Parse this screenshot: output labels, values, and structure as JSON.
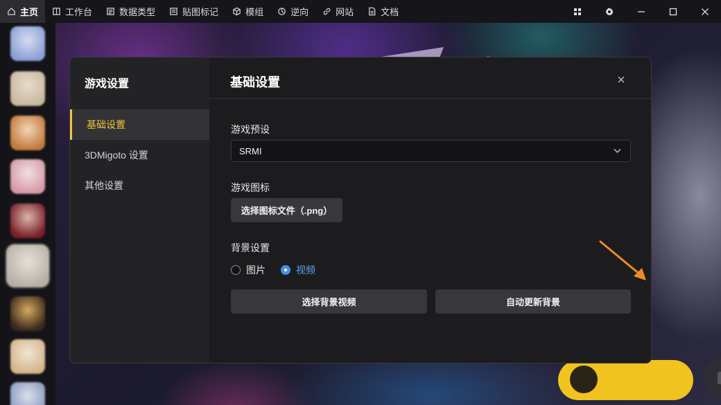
{
  "titlebar": {
    "tabs": [
      {
        "label": "主页",
        "icon": "home-icon",
        "active": true
      },
      {
        "label": "工作台",
        "icon": "workbench-icon"
      },
      {
        "label": "数据类型",
        "icon": "data-type-icon"
      },
      {
        "label": "贴图标记",
        "icon": "texture-mark-icon"
      },
      {
        "label": "模组",
        "icon": "cube-icon"
      },
      {
        "label": "逆向",
        "icon": "reverse-icon"
      },
      {
        "label": "网站",
        "icon": "link-icon"
      },
      {
        "label": "文档",
        "icon": "document-icon"
      }
    ],
    "controls": [
      "grid-icon",
      "settings-icon",
      "minimize-icon",
      "maximize-icon",
      "close-icon"
    ]
  },
  "rail": {
    "games": [
      {
        "color_a": "#8aa0d6",
        "color_b": "#d6dcef"
      },
      {
        "color_a": "#c8b9a0",
        "color_b": "#e8dccb"
      },
      {
        "color_a": "#c47a3c",
        "color_b": "#f0d6b6"
      },
      {
        "color_a": "#d69aa6",
        "color_b": "#f2e0e4"
      },
      {
        "color_a": "#7a1f2a",
        "color_b": "#d9b8a8"
      },
      {
        "color_a": "#b8b0a6",
        "color_b": "#e6e0d6",
        "selected": true
      },
      {
        "color_a": "#3a2a1c",
        "color_b": "#d9a860"
      },
      {
        "color_a": "#d6b48a",
        "color_b": "#f0e6d6"
      },
      {
        "color_a": "#8a9ac0",
        "color_b": "#dce0ea"
      }
    ]
  },
  "dialog": {
    "sidebar_title": "游戏设置",
    "nav": [
      {
        "label": "基础设置",
        "active": true
      },
      {
        "label": "3DMigoto 设置"
      },
      {
        "label": "其他设置"
      }
    ],
    "title": "基础设置",
    "preset": {
      "label": "游戏预设",
      "value": "SRMI"
    },
    "icon_section": {
      "label": "游戏图标",
      "button": "选择图标文件（.png）"
    },
    "background": {
      "label": "背景设置",
      "options": [
        {
          "label": "图片",
          "checked": false
        },
        {
          "label": "视频",
          "checked": true
        }
      ],
      "select_button": "选择背景视频",
      "auto_button": "自动更新背景"
    }
  },
  "colors": {
    "accent": "#f3c43c",
    "radio_selected": "#4a90e2",
    "arrow": "#f08a24"
  }
}
